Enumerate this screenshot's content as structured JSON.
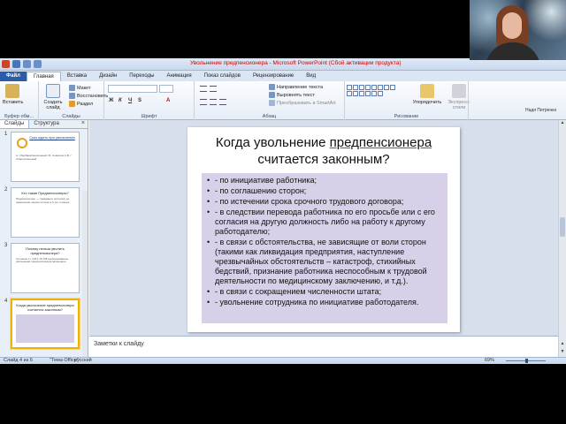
{
  "window_title": "Увольнение предпенсионера - Microsoft PowerPoint (Сбой активации продукта)",
  "tabs": [
    "Файл",
    "Главная",
    "Вставка",
    "Дизайн",
    "Переходы",
    "Анимация",
    "Показ слайдов",
    "Рецензирование",
    "Вид"
  ],
  "ribbon": {
    "paste": "Вставить",
    "clipboard_group": "Буфер обм...",
    "create_slide": "Создать слайд",
    "layout": "Макет",
    "restore": "Восстановить",
    "section": "Раздел",
    "slides_group": "Слайды",
    "font_group": "Шрифт",
    "paragraph_group": "Абзац",
    "text_direction": "Направление текста",
    "align_text": "Выровнять текст",
    "smartart": "Преобразовать в SmartArt",
    "arrange": "Упорядочить",
    "express_styles": "Экспресс-стили",
    "drawing_group": "Рисование",
    "user": "Надя Петренко"
  },
  "left_pane": {
    "tab_slides": "Слайды",
    "tab_outline": "Структура",
    "close": "×",
    "thumbs": [
      {
        "num": "1",
        "title": "Сказ ждать при увольнении",
        "body": "А. Сбербанк/пенсионный / Б. Советник С.В. / Сберегательный"
      },
      {
        "num": "2",
        "title": "Кто такие Предпенсионеры?",
        "body": "Предпенсионер — гражданин, которому до назначения пенсии осталось 5 лет и менее."
      },
      {
        "num": "3",
        "title": "Почему нельзя уволить предпенсионера?",
        "body": "Согласно ст. 144.1 УК РФ необоснованное увольнение предпенсионера запрещено."
      },
      {
        "num": "4",
        "title": "Когда увольнение предпенсионера считается законным?",
        "body": ""
      }
    ]
  },
  "slide": {
    "title_before": "Когда увольнение ",
    "title_underlined": "предпенсионера",
    "title_after": " считается законным?",
    "bullets": [
      "- по инициативе  работника;",
      "- по  соглашению сторон;",
      "- по истечении срока срочного трудового договора;",
      "- в следствии перевода работника по его просьбе или с его согласия на другую должность либо  на работу к другому работодателю;",
      "- в связи с обстоятельства, не зависящие от воли сторон (такими как ликвидация предприятия, наступление чрезвычайных обстоятельств – катастроф, стихийных бедствий, признание работника неспособным к трудовой деятельности по медицинскому заключению, и т.д.).",
      "- в связи с сокращением численности штата;",
      "- увольнение сотрудника по инициативе  работодателя."
    ]
  },
  "notes_placeholder": "Заметки к слайду",
  "status": {
    "slide_of": "Слайд 4 из 6",
    "theme": "\"Тема Office\"",
    "language": "русский",
    "zoom": "69%"
  }
}
